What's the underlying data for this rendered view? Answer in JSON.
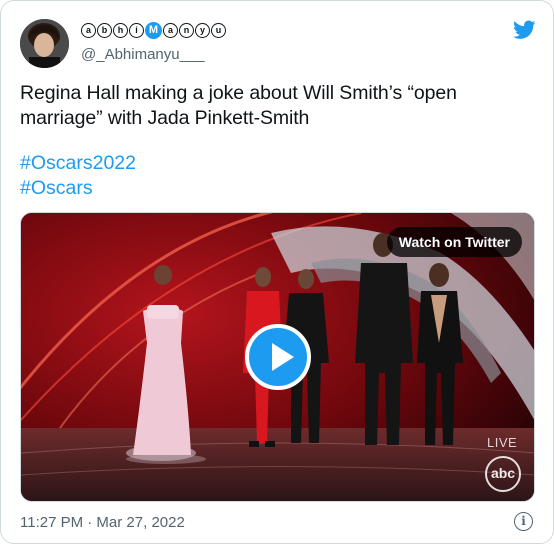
{
  "author": {
    "display_name_glyphs": [
      "a",
      "b",
      "h",
      "i",
      "m",
      "a",
      "n",
      "y",
      "u"
    ],
    "display_name_highlight": "M",
    "handle": "@_Abhimanyu___"
  },
  "tweet": {
    "text": "Regina Hall making a joke about Will Smith’s “open marriage” with Jada Pinkett-Smith",
    "hashtags": [
      "#Oscars2022",
      "#Oscars"
    ]
  },
  "media": {
    "watch_label": "Watch on Twitter",
    "live_label": "LIVE",
    "network_logo": "abc"
  },
  "timestamp": "11:27 PM · Mar 27, 2022",
  "icons": {
    "brand": "twitter-bird-icon",
    "info": "info-icon",
    "play": "play-icon"
  },
  "colors": {
    "brand_blue": "#1d9bf0",
    "text_primary": "#0f1419",
    "text_secondary": "#536471",
    "border": "#cfd9de"
  }
}
